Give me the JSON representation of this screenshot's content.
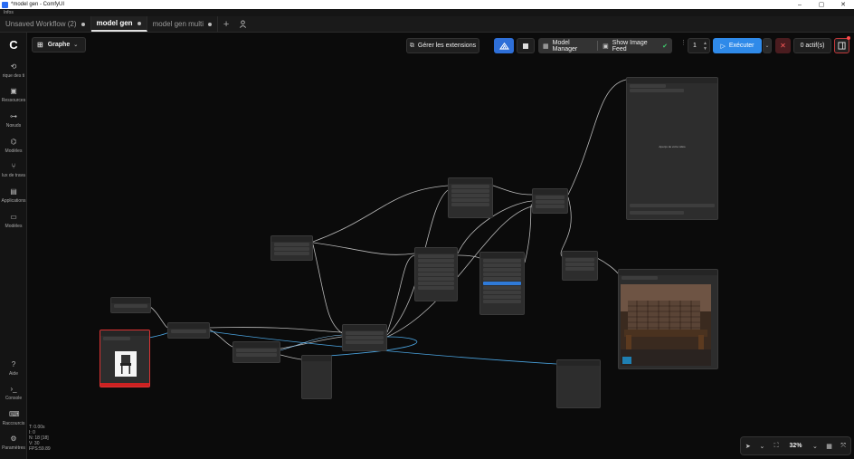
{
  "window": {
    "title": "*model gen - ComfyUI",
    "menu_label": "Infos",
    "minimize": "–",
    "maximize": "▢",
    "close": "✕"
  },
  "tabs": [
    {
      "label": "Unsaved Workflow (2)",
      "modified": true
    },
    {
      "label": "model gen",
      "modified": true,
      "active": true
    },
    {
      "label": "model gen multi",
      "modified": true
    }
  ],
  "tab_add": "+",
  "sidebar": {
    "items": [
      {
        "icon": "history-icon",
        "glyph": "⟲",
        "label": "rique des ti"
      },
      {
        "icon": "resources-icon",
        "glyph": "▣",
        "label": "Ressources"
      },
      {
        "icon": "nodes-icon",
        "glyph": "⊶",
        "label": "Nœuds"
      },
      {
        "icon": "models-icon",
        "glyph": "⌬",
        "label": "Modèles"
      },
      {
        "icon": "workflows-icon",
        "glyph": "⑂",
        "label": "lux de trava"
      },
      {
        "icon": "apps-icon",
        "glyph": "▤",
        "label": "Applications"
      },
      {
        "icon": "templates-icon",
        "glyph": "▭",
        "label": "Modèles"
      }
    ],
    "bottom_items": [
      {
        "icon": "help-icon",
        "glyph": "?",
        "label": "Aide"
      },
      {
        "icon": "console-icon",
        "glyph": "›_",
        "label": "Console"
      },
      {
        "icon": "shortcuts-icon",
        "glyph": "⌨",
        "label": "Raccourcis"
      },
      {
        "icon": "settings-icon",
        "glyph": "⚙",
        "label": "Paramètres"
      }
    ]
  },
  "stats": {
    "line1": "T: 0.00s",
    "line2": "I: 0",
    "line3": "N: 18 [18]",
    "line4": "V: 30",
    "line5": "FPS:59.89"
  },
  "graph_selector": {
    "label": "Graphe"
  },
  "toolbar": {
    "extensions_label": "Gérer les extensions",
    "model_manager_label": "Model Manager",
    "image_feed_label": "Show Image Feed",
    "queue_count": "1",
    "run_label": "Exécuter",
    "active_label": "0 actif(s)"
  },
  "canvas": {
    "preview_placeholder": "Aperçu de votre vidéo",
    "zoom": "32%"
  },
  "colors": {
    "accent": "#2f8ae9",
    "cancel": "#ff5a5a",
    "wire": "#b8b8b8",
    "wire_blue": "#4aa3df",
    "node_bg": "#2d2d2d"
  }
}
